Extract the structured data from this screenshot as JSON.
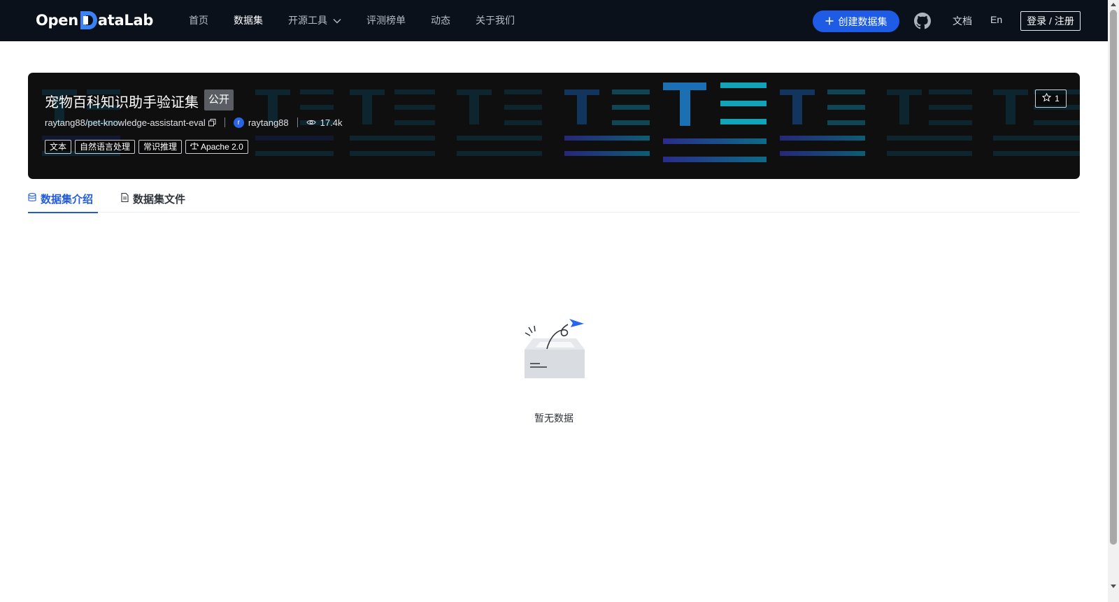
{
  "header": {
    "logo_text_left": "Open",
    "logo_text_right": "ataLab",
    "nav": [
      {
        "label": "首页"
      },
      {
        "label": "数据集"
      },
      {
        "label": "开源工具"
      },
      {
        "label": "评测榜单"
      },
      {
        "label": "动态"
      },
      {
        "label": "关于我们"
      }
    ],
    "create_label": "创建数据集",
    "docs_label": "文档",
    "lang_label": "En",
    "login_label": "登录 / 注册",
    "icons": [
      "plus-icon",
      "github-icon",
      "chevron-down-icon"
    ]
  },
  "dataset": {
    "title": "宠物百科知识助手验证集",
    "visibility": "公开",
    "repo": "raytang88/pet-knowledge-assistant-eval",
    "owner_initial": "r",
    "owner": "raytang88",
    "views": "17.4k",
    "tags": [
      "文本",
      "自然语言处理",
      "常识推理"
    ],
    "license": "Apache 2.0",
    "stars": "1"
  },
  "tabs": [
    {
      "label": "数据集介绍",
      "active": true
    },
    {
      "label": "数据集文件",
      "active": false
    }
  ],
  "empty": {
    "message": "暂无数据"
  },
  "colors": {
    "accent": "#1f5ae0",
    "topbar_bg": "#0b111b",
    "banner_bg": "#0f0f10"
  }
}
